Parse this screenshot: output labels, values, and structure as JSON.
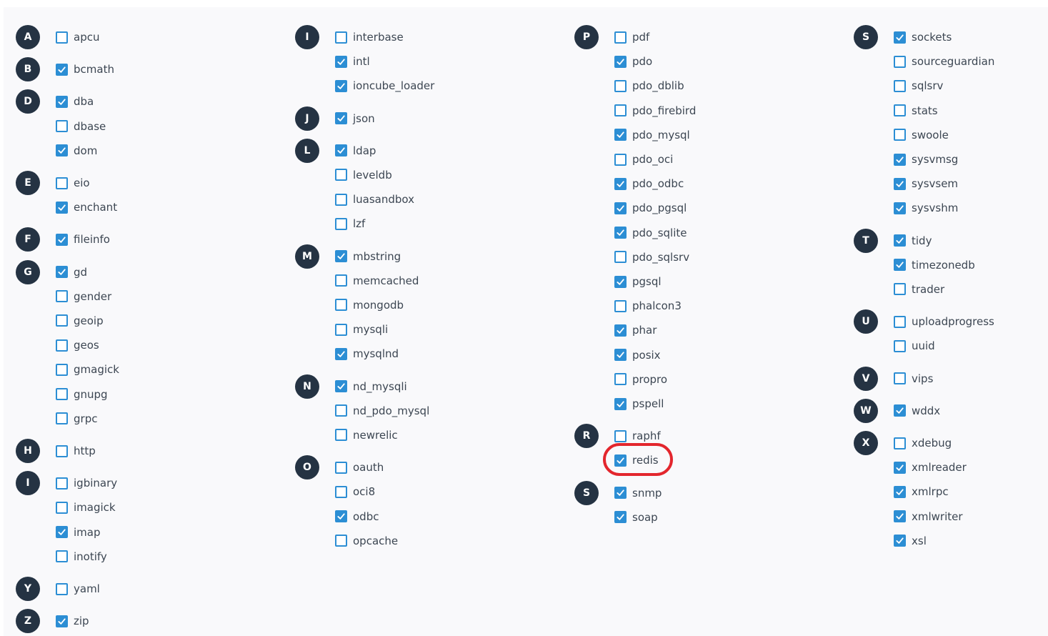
{
  "accent_color": "#2c8ed4",
  "badge_color": "#253343",
  "highlight_color": "#e3262d",
  "highlighted_extension": "redis",
  "columns": [
    {
      "groups": [
        {
          "letter": "A",
          "items": [
            {
              "name": "apcu",
              "checked": false
            }
          ]
        },
        {
          "letter": "B",
          "items": [
            {
              "name": "bcmath",
              "checked": true
            }
          ]
        },
        {
          "letter": "D",
          "items": [
            {
              "name": "dba",
              "checked": true
            },
            {
              "name": "dbase",
              "checked": false
            },
            {
              "name": "dom",
              "checked": true
            }
          ]
        },
        {
          "letter": "E",
          "items": [
            {
              "name": "eio",
              "checked": false
            },
            {
              "name": "enchant",
              "checked": true
            }
          ]
        },
        {
          "letter": "F",
          "items": [
            {
              "name": "fileinfo",
              "checked": true
            }
          ]
        },
        {
          "letter": "G",
          "items": [
            {
              "name": "gd",
              "checked": true
            },
            {
              "name": "gender",
              "checked": false
            },
            {
              "name": "geoip",
              "checked": false
            },
            {
              "name": "geos",
              "checked": false
            },
            {
              "name": "gmagick",
              "checked": false
            },
            {
              "name": "gnupg",
              "checked": false
            },
            {
              "name": "grpc",
              "checked": false
            }
          ]
        },
        {
          "letter": "H",
          "items": [
            {
              "name": "http",
              "checked": false
            }
          ]
        },
        {
          "letter": "I",
          "items": [
            {
              "name": "igbinary",
              "checked": false
            },
            {
              "name": "imagick",
              "checked": false
            },
            {
              "name": "imap",
              "checked": true
            },
            {
              "name": "inotify",
              "checked": false
            }
          ]
        },
        {
          "letter": "Y",
          "items": [
            {
              "name": "yaml",
              "checked": false
            }
          ]
        },
        {
          "letter": "Z",
          "items": [
            {
              "name": "zip",
              "checked": true
            }
          ]
        }
      ]
    },
    {
      "groups": [
        {
          "letter": "I",
          "items": [
            {
              "name": "interbase",
              "checked": false
            },
            {
              "name": "intl",
              "checked": true
            },
            {
              "name": "ioncube_loader",
              "checked": true
            }
          ]
        },
        {
          "letter": "J",
          "items": [
            {
              "name": "json",
              "checked": true
            }
          ]
        },
        {
          "letter": "L",
          "items": [
            {
              "name": "ldap",
              "checked": true
            },
            {
              "name": "leveldb",
              "checked": false
            },
            {
              "name": "luasandbox",
              "checked": false
            },
            {
              "name": "lzf",
              "checked": false
            }
          ]
        },
        {
          "letter": "M",
          "items": [
            {
              "name": "mbstring",
              "checked": true
            },
            {
              "name": "memcached",
              "checked": false
            },
            {
              "name": "mongodb",
              "checked": false
            },
            {
              "name": "mysqli",
              "checked": false
            },
            {
              "name": "mysqlnd",
              "checked": true
            }
          ]
        },
        {
          "letter": "N",
          "items": [
            {
              "name": "nd_mysqli",
              "checked": true
            },
            {
              "name": "nd_pdo_mysql",
              "checked": false
            },
            {
              "name": "newrelic",
              "checked": false
            }
          ]
        },
        {
          "letter": "O",
          "items": [
            {
              "name": "oauth",
              "checked": false
            },
            {
              "name": "oci8",
              "checked": false
            },
            {
              "name": "odbc",
              "checked": true
            },
            {
              "name": "opcache",
              "checked": false
            }
          ]
        }
      ]
    },
    {
      "groups": [
        {
          "letter": "P",
          "items": [
            {
              "name": "pdf",
              "checked": false
            },
            {
              "name": "pdo",
              "checked": true
            },
            {
              "name": "pdo_dblib",
              "checked": false
            },
            {
              "name": "pdo_firebird",
              "checked": false
            },
            {
              "name": "pdo_mysql",
              "checked": true
            },
            {
              "name": "pdo_oci",
              "checked": false
            },
            {
              "name": "pdo_odbc",
              "checked": true
            },
            {
              "name": "pdo_pgsql",
              "checked": true
            },
            {
              "name": "pdo_sqlite",
              "checked": true
            },
            {
              "name": "pdo_sqlsrv",
              "checked": false
            },
            {
              "name": "pgsql",
              "checked": true
            },
            {
              "name": "phalcon3",
              "checked": false
            },
            {
              "name": "phar",
              "checked": true
            },
            {
              "name": "posix",
              "checked": true
            },
            {
              "name": "propro",
              "checked": false
            },
            {
              "name": "pspell",
              "checked": true
            }
          ]
        },
        {
          "letter": "R",
          "items": [
            {
              "name": "raphf",
              "checked": false
            },
            {
              "name": "redis",
              "checked": true
            }
          ]
        },
        {
          "letter": "S",
          "items": [
            {
              "name": "snmp",
              "checked": true
            },
            {
              "name": "soap",
              "checked": true
            }
          ]
        }
      ]
    },
    {
      "groups": [
        {
          "letter": "S",
          "items": [
            {
              "name": "sockets",
              "checked": true
            },
            {
              "name": "sourceguardian",
              "checked": false
            },
            {
              "name": "sqlsrv",
              "checked": false
            },
            {
              "name": "stats",
              "checked": false
            },
            {
              "name": "swoole",
              "checked": false
            },
            {
              "name": "sysvmsg",
              "checked": true
            },
            {
              "name": "sysvsem",
              "checked": true
            },
            {
              "name": "sysvshm",
              "checked": true
            }
          ]
        },
        {
          "letter": "T",
          "items": [
            {
              "name": "tidy",
              "checked": true
            },
            {
              "name": "timezonedb",
              "checked": true
            },
            {
              "name": "trader",
              "checked": false
            }
          ]
        },
        {
          "letter": "U",
          "items": [
            {
              "name": "uploadprogress",
              "checked": false
            },
            {
              "name": "uuid",
              "checked": false
            }
          ]
        },
        {
          "letter": "V",
          "items": [
            {
              "name": "vips",
              "checked": false
            }
          ]
        },
        {
          "letter": "W",
          "items": [
            {
              "name": "wddx",
              "checked": true
            }
          ]
        },
        {
          "letter": "X",
          "items": [
            {
              "name": "xdebug",
              "checked": false
            },
            {
              "name": "xmlreader",
              "checked": true
            },
            {
              "name": "xmlrpc",
              "checked": true
            },
            {
              "name": "xmlwriter",
              "checked": true
            },
            {
              "name": "xsl",
              "checked": true
            }
          ]
        }
      ]
    }
  ]
}
